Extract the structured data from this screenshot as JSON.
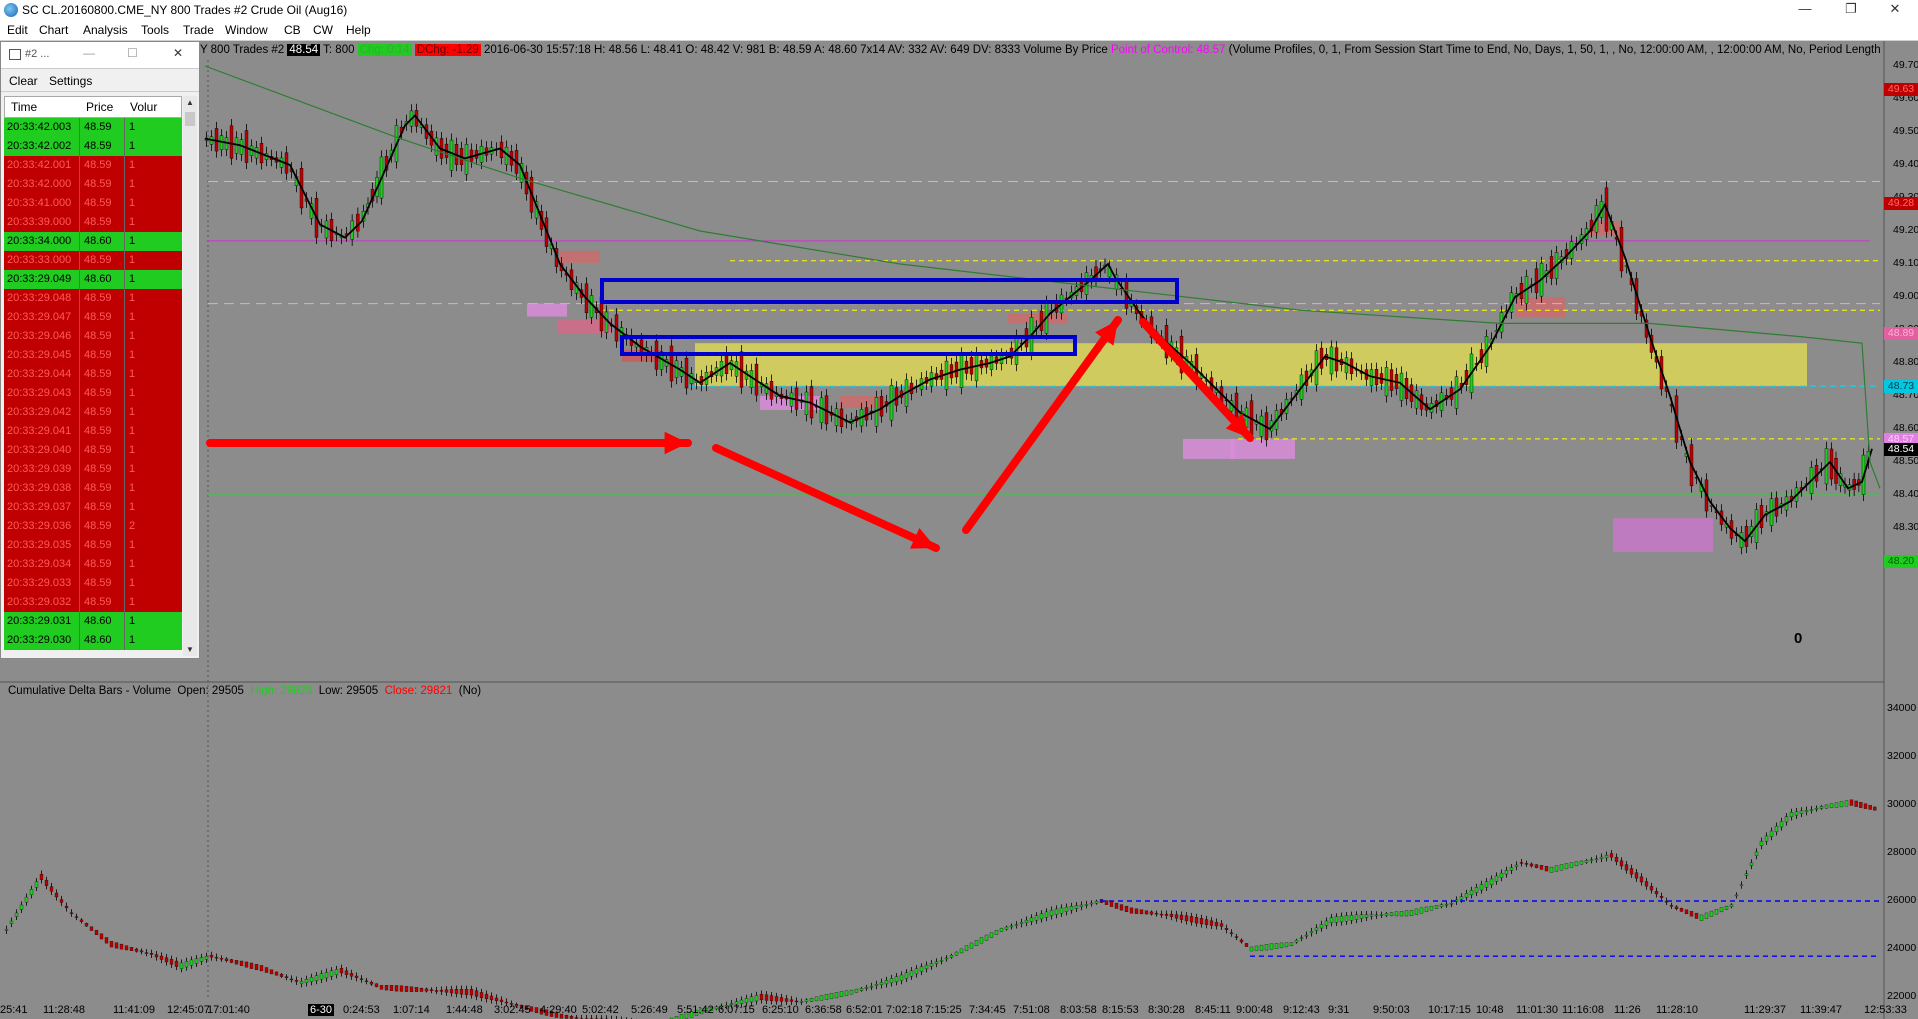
{
  "window": {
    "title": "SC CL.20160800.CME_NY  800 Trades  #2  Crude Oil (Aug16)",
    "minimize": "—",
    "maximize": "❐",
    "close": "✕"
  },
  "menu": [
    "Edit",
    "Chart",
    "Analysis",
    "Tools",
    "Trade",
    "Window",
    "CB",
    "CW",
    "Help"
  ],
  "tas_panel": {
    "title": "#2 ...",
    "clear": "Clear",
    "settings": "Settings",
    "columns": [
      "Time",
      "Price",
      "Volur"
    ],
    "rows": [
      {
        "time": "20:33:42.003",
        "price": "48.59",
        "vol": "1",
        "side": "g"
      },
      {
        "time": "20:33:42.002",
        "price": "48.59",
        "vol": "1",
        "side": "g"
      },
      {
        "time": "20:33:42.001",
        "price": "48.59",
        "vol": "1",
        "side": "r"
      },
      {
        "time": "20:33:42.000",
        "price": "48.59",
        "vol": "1",
        "side": "r"
      },
      {
        "time": "20:33:41.000",
        "price": "48.59",
        "vol": "1",
        "side": "r"
      },
      {
        "time": "20:33:39.000",
        "price": "48.59",
        "vol": "1",
        "side": "r"
      },
      {
        "time": "20:33:34.000",
        "price": "48.60",
        "vol": "1",
        "side": "g"
      },
      {
        "time": "20:33:33.000",
        "price": "48.59",
        "vol": "1",
        "side": "r"
      },
      {
        "time": "20:33:29.049",
        "price": "48.60",
        "vol": "1",
        "side": "g"
      },
      {
        "time": "20:33:29.048",
        "price": "48.59",
        "vol": "1",
        "side": "r"
      },
      {
        "time": "20:33:29.047",
        "price": "48.59",
        "vol": "1",
        "side": "r"
      },
      {
        "time": "20:33:29.046",
        "price": "48.59",
        "vol": "1",
        "side": "r"
      },
      {
        "time": "20:33:29.045",
        "price": "48.59",
        "vol": "1",
        "side": "r"
      },
      {
        "time": "20:33:29.044",
        "price": "48.59",
        "vol": "1",
        "side": "r"
      },
      {
        "time": "20:33:29.043",
        "price": "48.59",
        "vol": "1",
        "side": "r"
      },
      {
        "time": "20:33:29.042",
        "price": "48.59",
        "vol": "1",
        "side": "r"
      },
      {
        "time": "20:33:29.041",
        "price": "48.59",
        "vol": "1",
        "side": "r"
      },
      {
        "time": "20:33:29.040",
        "price": "48.59",
        "vol": "1",
        "side": "r"
      },
      {
        "time": "20:33:29.039",
        "price": "48.59",
        "vol": "1",
        "side": "r"
      },
      {
        "time": "20:33:29.038",
        "price": "48.59",
        "vol": "1",
        "side": "r"
      },
      {
        "time": "20:33:29.037",
        "price": "48.59",
        "vol": "1",
        "side": "r"
      },
      {
        "time": "20:33:29.036",
        "price": "48.59",
        "vol": "2",
        "side": "r"
      },
      {
        "time": "20:33:29.035",
        "price": "48.59",
        "vol": "1",
        "side": "r"
      },
      {
        "time": "20:33:29.034",
        "price": "48.59",
        "vol": "1",
        "side": "r"
      },
      {
        "time": "20:33:29.033",
        "price": "48.59",
        "vol": "1",
        "side": "r"
      },
      {
        "time": "20:33:29.032",
        "price": "48.59",
        "vol": "1",
        "side": "r"
      },
      {
        "time": "20:33:29.031",
        "price": "48.60",
        "vol": "1",
        "side": "g"
      },
      {
        "time": "20:33:29.030",
        "price": "48.60",
        "vol": "1",
        "side": "g"
      }
    ]
  },
  "infobar": {
    "prefix": "Y  800 Trades  #2",
    "last": "48.54",
    "trades": "T: 800",
    "chg": "Chg: 0.14",
    "dchg": "DChg: -1.29",
    "details": "2016-06-30  15:57:18  H: 48.56  L: 48.41  O: 48.42  V: 981  B: 48.59  A: 48.60  7x14  AV: 332  AV: 649  DV: 8333  Volume By Price",
    "poc": "Point of Control: 48.57",
    "params": "(Volume Profiles, 0, 1, From Session Start Time to End, No, Days, 1, 50, 1, , No, 12:00:00 AM, , 12:00:00 AM, No, Period Length"
  },
  "lower": {
    "label": "Cumulative Delta Bars - Volume",
    "open": "Open: 29505",
    "high": "High: 29828",
    "low": "Low: 29505",
    "close": "Close: 29821",
    "extra": "(No)"
  },
  "price_axis": [
    "49.70",
    "49.60",
    "49.50",
    "49.40",
    "49.30",
    "49.20",
    "49.10",
    "49.00",
    "48.90",
    "48.80",
    "48.70",
    "48.60",
    "48.50",
    "48.40",
    "48.30",
    "48.20"
  ],
  "price_tags": [
    {
      "text": "49.63",
      "bg": "#c00000",
      "fg": "#ff6a6a",
      "price": 49.63
    },
    {
      "text": "49.28",
      "bg": "#c00000",
      "fg": "#ff6a6a",
      "price": 49.285
    },
    {
      "text": "48.89",
      "bg": "#e060a0",
      "fg": "#ffb0d8",
      "price": 48.89
    },
    {
      "text": "48.73",
      "bg": "#00c8e0",
      "fg": "#004050",
      "price": 48.73
    },
    {
      "text": "48.57",
      "bg": "#e080e0",
      "fg": "#ffd0ff",
      "price": 48.57
    },
    {
      "text": "48.54",
      "bg": "#000000",
      "fg": "#ffffff",
      "price": 48.54
    },
    {
      "text": "48.20",
      "bg": "#1fcc1f",
      "fg": "#006000",
      "price": 48.2
    }
  ],
  "delta_axis": [
    "34000",
    "32000",
    "30000",
    "28000",
    "26000",
    "24000",
    "22000"
  ],
  "time_axis": [
    "25:41",
    "11:28:48",
    "11:41:09",
    "12:45:07",
    "17:01:40",
    "6-30",
    "0:24:53",
    "1:07:14",
    "1:44:48",
    "3:02:45",
    "4:29:40",
    "5:02:42",
    "5:26:49",
    "5:51:42",
    "6:07:15",
    "6:25:10",
    "6:36:58",
    "6:52:01",
    "7:02:18",
    "7:15:25",
    "7:34:45",
    "7:51:08",
    "8:03:58",
    "8:15:53",
    "8:30:28",
    "8:45:11",
    "9:00:48",
    "9:12:43",
    "9:31",
    "9:50:03",
    "10:17:15",
    "10:48",
    "11:01:30",
    "11:16:08",
    "11:26",
    "11:28:10",
    "11:29:37",
    "11:39:47",
    "12:53:33"
  ],
  "annotation_zero": "0",
  "colors": {
    "chart_bg": "#8c8c8c",
    "up_candle": "#1fcc1f",
    "down_candle": "#c00000",
    "poc_band": "#e6e050",
    "box": "#0000cc",
    "arrow": "#ff0000",
    "ma_black": "#000000",
    "ma_green": "#2e7d32"
  }
}
